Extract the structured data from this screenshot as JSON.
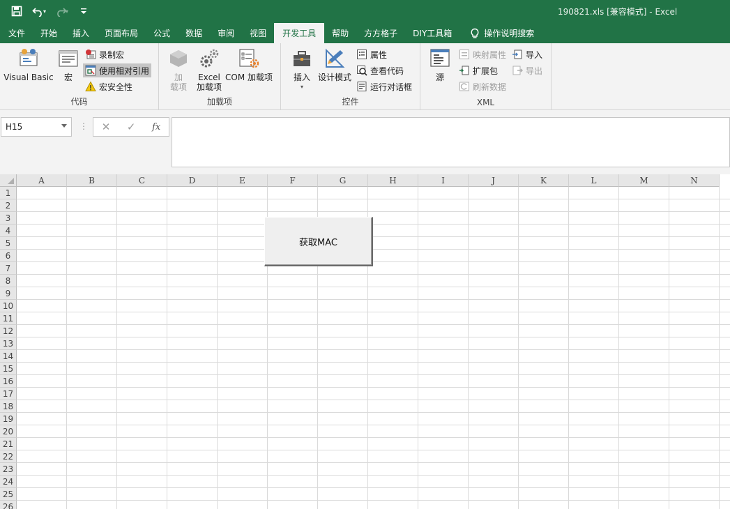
{
  "window": {
    "title": "190821.xls  [兼容模式]  -  Excel"
  },
  "quick_access": {
    "save_icon": "save-icon",
    "undo_icon": "undo-icon",
    "redo_icon": "redo-icon",
    "customize_icon": "customize-qat-icon"
  },
  "tabs": [
    "文件",
    "开始",
    "插入",
    "页面布局",
    "公式",
    "数据",
    "审阅",
    "视图",
    "开发工具",
    "帮助",
    "方方格子",
    "DIY工具箱"
  ],
  "active_tab": "开发工具",
  "search": {
    "label": "操作说明搜索",
    "icon": "lightbulb-icon"
  },
  "ribbon": {
    "code": {
      "label": "代码",
      "visual_basic": "Visual Basic",
      "macros": "宏",
      "record_macro": "录制宏",
      "relative_ref": "使用相对引用",
      "macro_security": "宏安全性"
    },
    "addins": {
      "label": "加载项",
      "addins_line1": "加",
      "addins_line2": "载项",
      "excel_line1": "Excel",
      "excel_line2": "加载项",
      "com": "COM 加载项"
    },
    "controls": {
      "label": "控件",
      "insert": "插入",
      "design_mode": "设计模式",
      "properties": "属性",
      "view_code": "查看代码",
      "run_dialog": "运行对话框"
    },
    "xml": {
      "label": "XML",
      "source": "源",
      "map_properties": "映射属性",
      "expansion_packs": "扩展包",
      "refresh_data": "刷新数据",
      "import": "导入",
      "export": "导出"
    }
  },
  "formula_bar": {
    "name_box": "H15",
    "cancel_glyph": "✕",
    "enter_glyph": "✓",
    "fx_label": "fx",
    "value": ""
  },
  "sheet": {
    "columns": [
      "A",
      "B",
      "C",
      "D",
      "E",
      "F",
      "G",
      "H",
      "I",
      "J",
      "K",
      "L",
      "M",
      "N"
    ],
    "rows": [
      "1",
      "2",
      "3",
      "4",
      "5",
      "6",
      "7",
      "8",
      "9",
      "10",
      "11",
      "12",
      "13",
      "14",
      "15",
      "16",
      "17",
      "18",
      "19",
      "20",
      "21",
      "22",
      "23",
      "24",
      "25",
      "26"
    ],
    "button_label": "获取MAC"
  },
  "colors": {
    "accent": "#217346",
    "ribbon_bg": "#f3f3f3",
    "header_bg": "#e6e6e6",
    "gridline": "#dadada"
  }
}
